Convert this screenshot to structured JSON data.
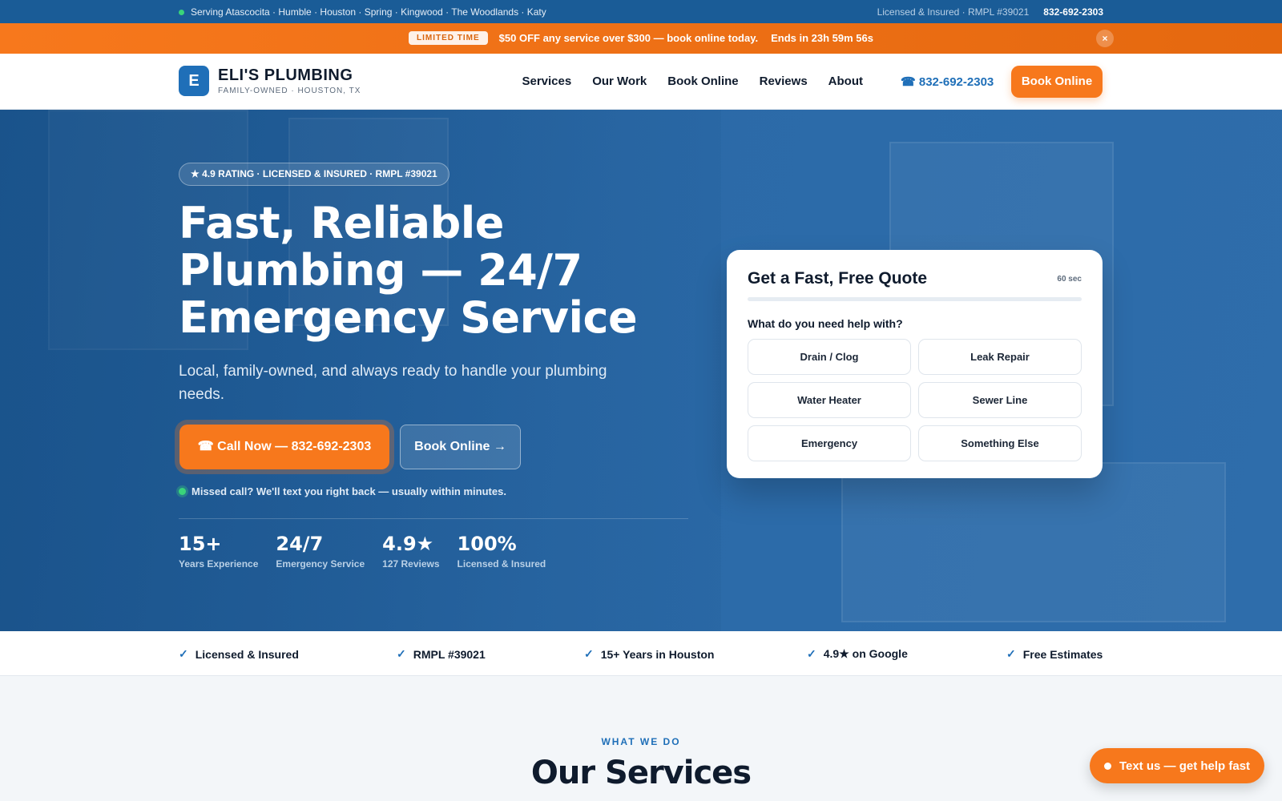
{
  "topbar": {
    "service_areas": "Serving Atascocita · Humble · Houston · Spring · Kingwood · The Woodlands · Katy",
    "license": "Licensed & Insured · RMPL #39021",
    "phone": "832-692-2303"
  },
  "promo": {
    "badge": "LIMITED TIME",
    "message": "$50 OFF any service over $300 — book online today.",
    "countdown": "Ends in 23h 59m 56s",
    "close_icon": "close-icon",
    "close_label": "×"
  },
  "nav": {
    "logo_letter": "E",
    "brand": "ELI'S PLUMBING",
    "tagline": "FAMILY-OWNED · HOUSTON, TX",
    "menu": [
      "Services",
      "Our Work",
      "Book Online",
      "Reviews",
      "About"
    ],
    "phone": "☎ 832-692-2303",
    "cta": "Book Online"
  },
  "hero": {
    "rating_pill": "★ 4.9 RATING · LICENSED & INSURED · RMPL #39021",
    "headline": "Fast, Reliable Plumbing — 24/7 Emergency Service",
    "subheadline": "Local, family-owned, and always ready to handle your plumbing needs.",
    "call_cta": "☎ Call Now — 832-692-2303",
    "book_cta": "Book Online →",
    "missed_call": "Missed call? We'll text you right back — usually within minutes.",
    "stats": [
      {
        "num": "15+",
        "label": "Years Experience"
      },
      {
        "num": "24/7",
        "label": "Emergency Service"
      },
      {
        "num": "4.9★",
        "label": "127 Reviews"
      },
      {
        "num": "100%",
        "label": "Licensed & Insured"
      }
    ]
  },
  "quote": {
    "title": "Get a Fast, Free Quote",
    "time": "60 sec",
    "question": "What do you need help with?",
    "options": [
      "Drain / Clog",
      "Leak Repair",
      "Water Heater",
      "Sewer Line",
      "Emergency",
      "Something Else"
    ]
  },
  "trust": [
    "Licensed & Insured",
    "RMPL #39021",
    "15+ Years in Houston",
    "4.9★ on Google",
    "Free Estimates"
  ],
  "trust_icon": "check-icon",
  "services": {
    "eyebrow": "WHAT WE DO",
    "title": "Our Services"
  },
  "floating": {
    "text_us": "Text us — get help fast"
  },
  "colors": {
    "brand_blue": "#1f6fb8",
    "accent_orange": "#f7781c",
    "topbar": "#1a5c97"
  }
}
